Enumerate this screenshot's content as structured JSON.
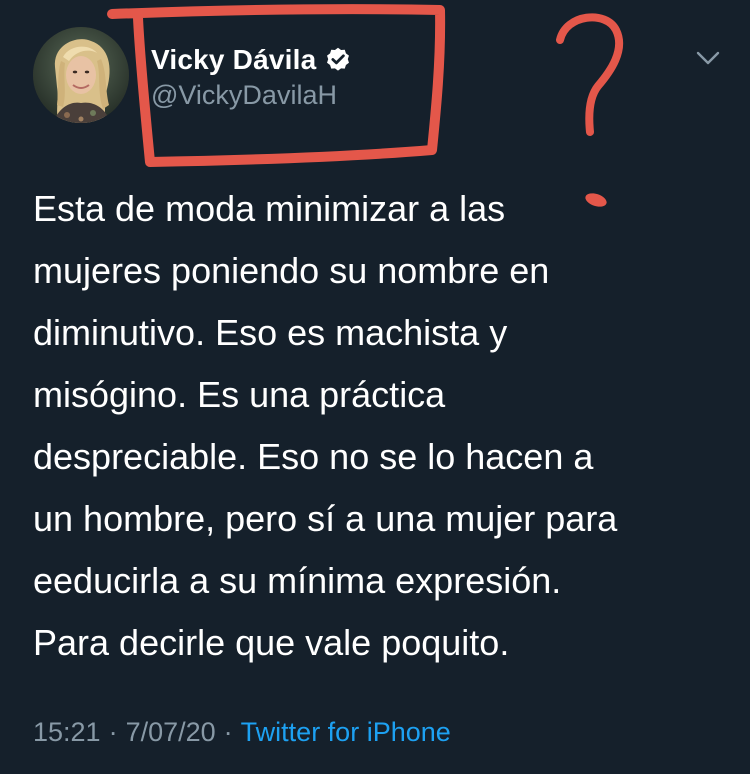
{
  "author": {
    "display_name": "Vicky Dávila",
    "handle": "@VickyDavilaH",
    "verified": true
  },
  "tweet": {
    "lines": [
      "Esta de moda minimizar a las",
      "mujeres poniendo su nombre en",
      "diminutivo. Eso es machista y",
      "misógino. Es una práctica",
      "despreciable. Eso no se lo hacen a",
      "un hombre, pero sí a una mujer para",
      "eeducirla a su mínima expresión.",
      "Para decirle que vale poquito."
    ]
  },
  "meta": {
    "time": "15:21",
    "date": "7/07/20",
    "source": "Twitter for iPhone"
  },
  "annotation": {
    "mark": "?",
    "color": "#e4574a"
  },
  "colors": {
    "background": "#15202b",
    "secondary_text": "#8899a6",
    "link": "#1da1f2"
  },
  "icons": {
    "verified": "verified-badge-icon",
    "more": "chevron-down-icon"
  }
}
